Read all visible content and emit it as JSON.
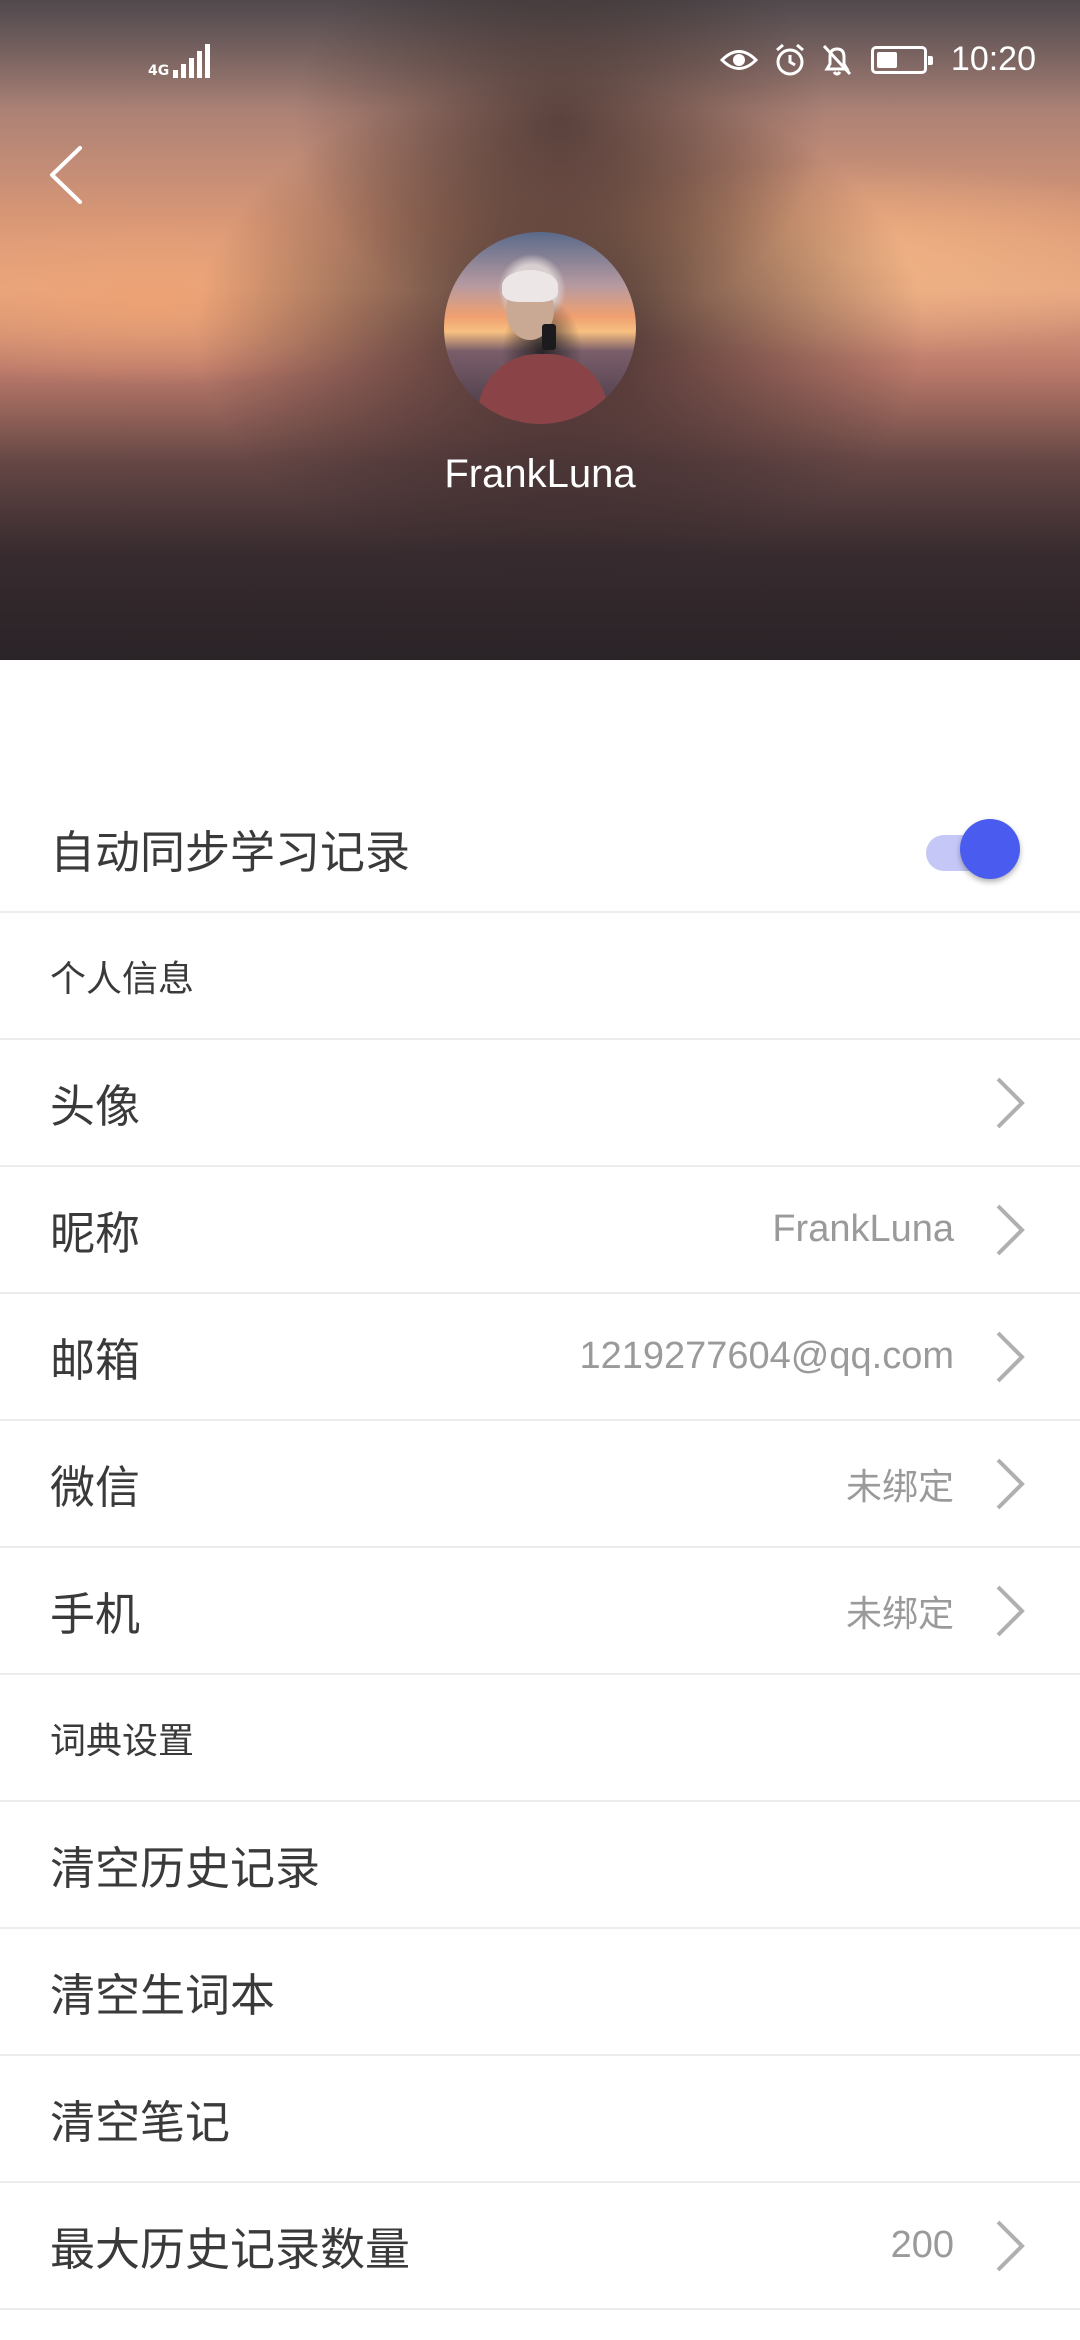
{
  "status_bar": {
    "network": "4G",
    "time": "10:20",
    "battery_level": 0.45,
    "icons": [
      "eye-icon",
      "alarm-icon",
      "bell-off-icon",
      "battery-icon"
    ]
  },
  "header": {
    "username": "FrankLuna"
  },
  "settings": {
    "auto_sync": {
      "label": "自动同步学习记录",
      "enabled": true
    },
    "personal_section": "个人信息",
    "avatar": {
      "label": "头像"
    },
    "nickname": {
      "label": "昵称",
      "value": "FrankLuna"
    },
    "email": {
      "label": "邮箱",
      "value": "1219277604@qq.com"
    },
    "wechat": {
      "label": "微信",
      "value": "未绑定"
    },
    "phone": {
      "label": "手机",
      "value": "未绑定"
    },
    "dictionary_section": "词典设置",
    "clear_history": {
      "label": "清空历史记录"
    },
    "clear_vocab": {
      "label": "清空生词本"
    },
    "clear_notes": {
      "label": "清空笔记"
    },
    "max_history": {
      "label": "最大历史记录数量",
      "value": "200"
    }
  },
  "colors": {
    "accent": "#4a5cf0",
    "accent_track": "#c5c8f7",
    "divider": "#ececec",
    "secondary_text": "#9a9a9a"
  }
}
